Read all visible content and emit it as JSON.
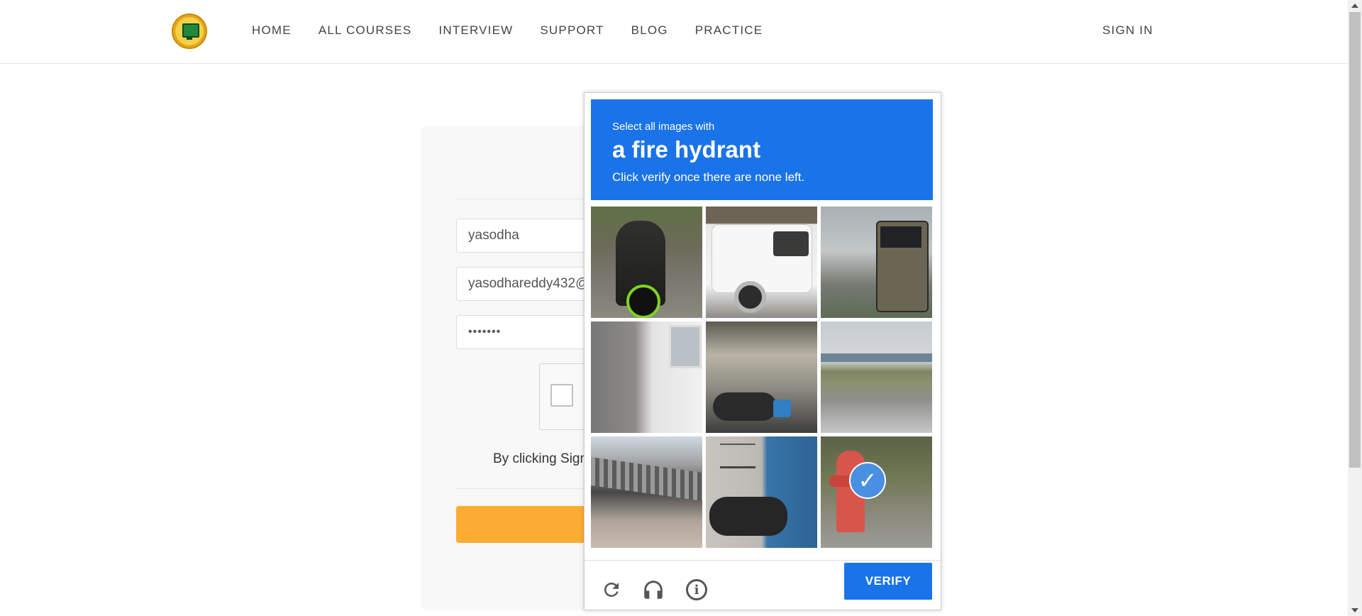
{
  "nav": {
    "items": [
      "HOME",
      "ALL COURSES",
      "INTERVIEW",
      "SUPPORT",
      "BLOG",
      "PRACTICE"
    ],
    "signin": "SIGN IN"
  },
  "form": {
    "name_value": "yasodha",
    "email_value": "yasodhareddy432@",
    "password_value": "•••••••",
    "terms_text": "By clicking Sign"
  },
  "captcha": {
    "prompt_small": "Select all images with",
    "prompt_target": "a fire hydrant",
    "prompt_instruction": "Click verify once there are none left.",
    "verify_label": "VERIFY",
    "tiles": [
      {
        "icon": "motorcycle-rider-image",
        "selected": false
      },
      {
        "icon": "white-car-image",
        "selected": false
      },
      {
        "icon": "bus-image",
        "selected": false
      },
      {
        "icon": "building-wall-image",
        "selected": false
      },
      {
        "icon": "bicycles-alley-image",
        "selected": false
      },
      {
        "icon": "highway-bridge-image",
        "selected": false
      },
      {
        "icon": "roof-image",
        "selected": false
      },
      {
        "icon": "parked-motorcycle-image",
        "selected": false
      },
      {
        "icon": "fire-hydrant-image",
        "selected": true
      }
    ],
    "colors": {
      "accent": "#1a73e8",
      "submit_button": "#fdac33"
    }
  }
}
